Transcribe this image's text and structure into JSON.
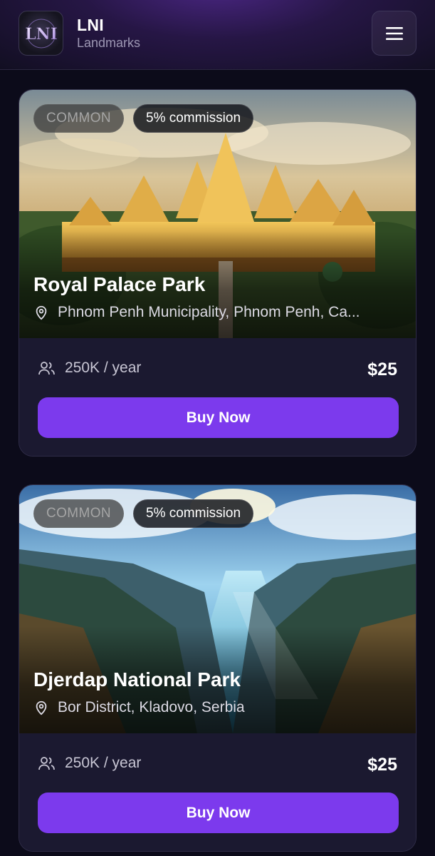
{
  "header": {
    "logo_text": "LNI",
    "title": "LNI",
    "subtitle": "Landmarks",
    "menu_icon": "hamburger-menu-icon"
  },
  "colors": {
    "accent": "#7c3aed",
    "background": "#0c0b1a",
    "card": "#1b1930"
  },
  "cards": [
    {
      "rarity": "COMMON",
      "commission": "5% commission",
      "title": "Royal Palace Park",
      "location": "Phnom Penh Municipality, Phnom Penh, Ca...",
      "location_icon": "map-pin-icon",
      "visitors": "250K / year",
      "visitors_icon": "users-icon",
      "price": "$25",
      "button": "Buy Now"
    },
    {
      "rarity": "COMMON",
      "commission": "5% commission",
      "title": "Djerdap National Park",
      "location": "Bor District, Kladovo, Serbia",
      "location_icon": "map-pin-icon",
      "visitors": "250K / year",
      "visitors_icon": "users-icon",
      "price": "$25",
      "button": "Buy Now"
    }
  ]
}
